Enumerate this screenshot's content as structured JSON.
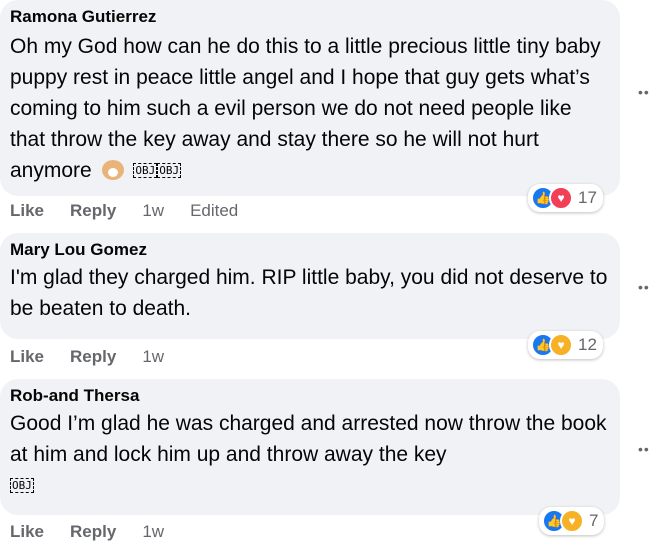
{
  "comments": [
    {
      "author": "Ramona Gutierrez",
      "text": "Oh my God how can he do this to a little precious little tiny baby puppy rest in peace little angel and I hope that guy gets what’s coming to him such a evil person we do not need people like that throw the key away and stay there so he will not hurt anymore",
      "obj_tags": [
        "OBJ",
        "OBJ"
      ],
      "like_label": "Like",
      "reply_label": "Reply",
      "time": "1w",
      "edited": "Edited",
      "reaction_count": "17",
      "reaction_icons": [
        "like-icon",
        "love-icon"
      ]
    },
    {
      "author": "Mary Lou Gomez",
      "text": "I'm glad they charged him. RIP little baby, you did not deserve to be beaten to death.",
      "like_label": "Like",
      "reply_label": "Reply",
      "time": "1w",
      "reaction_count": "12",
      "reaction_icons": [
        "like-icon",
        "care-icon"
      ]
    },
    {
      "author": "Rob-and Thersa",
      "text": "Good I’m glad he was charged and arrested now throw the book at him and lock him up and throw away the key",
      "obj_tags": [
        "OBJ"
      ],
      "like_label": "Like",
      "reply_label": "Reply",
      "time": "1w",
      "reaction_count": "7",
      "reaction_icons": [
        "like-icon",
        "care-icon"
      ]
    }
  ],
  "colors": {
    "bubble": "#f0f2f5",
    "meta_text": "#65676b",
    "like": "#1877f2",
    "love": "#f33e58",
    "care": "#f7b125"
  }
}
